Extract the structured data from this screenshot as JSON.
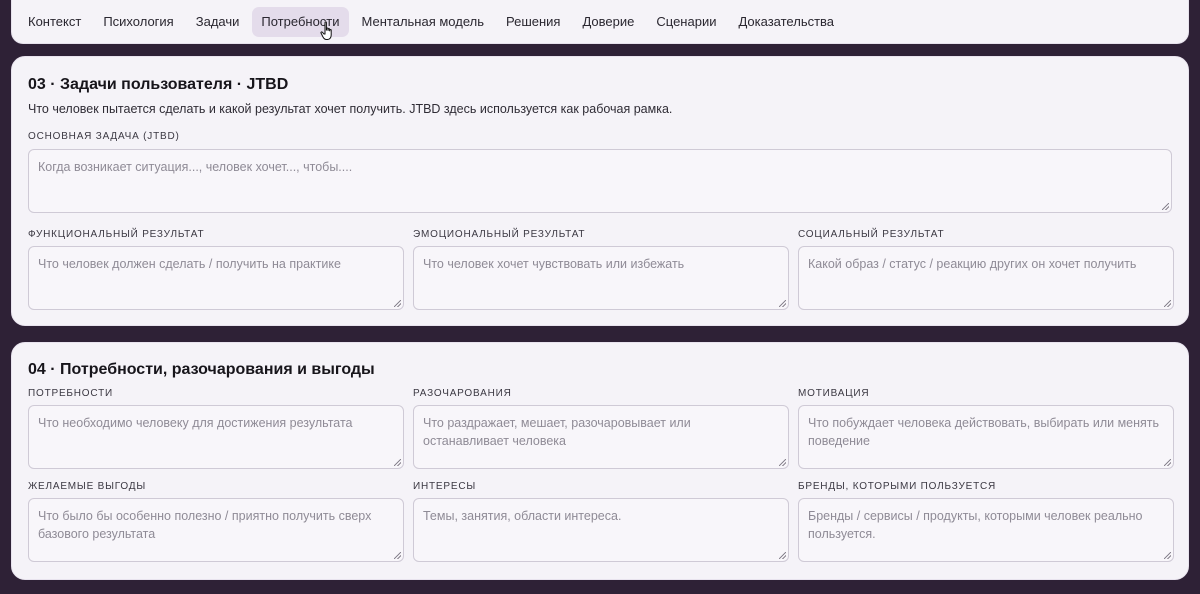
{
  "nav": {
    "tabs": [
      "Контекст",
      "Психология",
      "Задачи",
      "Потребности",
      "Ментальная модель",
      "Решения",
      "Доверие",
      "Сценарии",
      "Доказательства"
    ],
    "active_index": 3
  },
  "section03": {
    "title": "03 · Задачи пользователя · JTBD",
    "description": "Что человек пытается сделать и какой результат хочет получить. JTBD здесь используется как рабочая рамка.",
    "main_job": {
      "label": "ОСНОВНАЯ ЗАДАЧА (JTBD)",
      "placeholder": "Когда возникает ситуация..., человек хочет..., чтобы...."
    },
    "fields": [
      {
        "label": "ФУНКЦИОНАЛЬНЫЙ РЕЗУЛЬТАТ",
        "placeholder": "Что человек должен сделать / получить на практике"
      },
      {
        "label": "ЭМОЦИОНАЛЬНЫЙ РЕЗУЛЬТАТ",
        "placeholder": "Что человек хочет чувствовать или избежать"
      },
      {
        "label": "СОЦИАЛЬНЫЙ РЕЗУЛЬТАТ",
        "placeholder": "Какой образ / статус / реакцию других он хочет получить"
      }
    ]
  },
  "section04": {
    "title": "04 · Потребности, разочарования и выгоды",
    "fields": [
      {
        "label": "ПОТРЕБНОСТИ",
        "placeholder": "Что необходимо человеку для достижения результата"
      },
      {
        "label": "РАЗОЧАРОВАНИЯ",
        "placeholder": "Что раздражает, мешает, разочаровывает или останавливает человека"
      },
      {
        "label": "МОТИВАЦИЯ",
        "placeholder": "Что побуждает человека действовать, выбирать или менять поведение"
      },
      {
        "label": "ЖЕЛАЕМЫЕ ВЫГОДЫ",
        "placeholder": "Что было бы особенно полезно / приятно получить сверх базового результата"
      },
      {
        "label": "ИНТЕРЕСЫ",
        "placeholder": "Темы, занятия, области интереса."
      },
      {
        "label": "БРЕНДЫ, КОТОРЫМИ ПОЛЬЗУЕТСЯ",
        "placeholder": "Бренды / сервисы / продукты, которыми человек реально пользуется."
      }
    ]
  }
}
